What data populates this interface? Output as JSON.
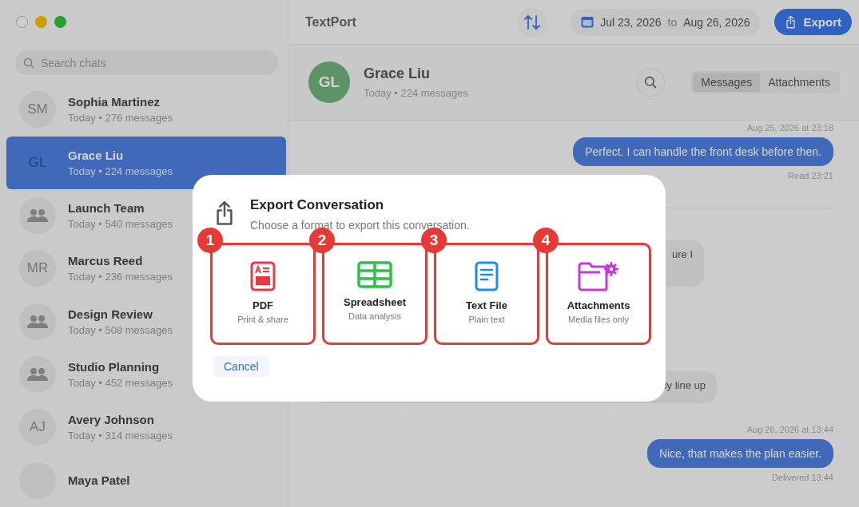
{
  "window": {
    "title": "TextPort"
  },
  "toolbar": {
    "date_from": "Jul 23, 2026",
    "date_sep": "to",
    "date_to": "Aug 26, 2026",
    "export_label": "Export"
  },
  "sidebar": {
    "search": {
      "placeholder": "Search chats"
    },
    "items": [
      {
        "kind": "person",
        "initials": "SM",
        "name": "Sophia Martinez",
        "meta": "Today • 276 messages",
        "selected": false
      },
      {
        "kind": "person",
        "initials": "GL",
        "name": "Grace Liu",
        "meta": "Today • 224 messages",
        "selected": true
      },
      {
        "kind": "group",
        "name": "Launch Team",
        "meta": "Today • 540 messages",
        "selected": false
      },
      {
        "kind": "person",
        "initials": "MR",
        "name": "Marcus Reed",
        "meta": "Today • 236 messages",
        "selected": false
      },
      {
        "kind": "group",
        "name": "Design Review",
        "meta": "Today • 508 messages",
        "selected": false
      },
      {
        "kind": "group",
        "name": "Studio Planning",
        "meta": "Today • 452 messages",
        "selected": false
      },
      {
        "kind": "person",
        "initials": "AJ",
        "name": "Avery Johnson",
        "meta": "Today • 314 messages",
        "selected": false
      },
      {
        "kind": "person",
        "name": "Maya Patel",
        "selected": false
      }
    ]
  },
  "chat": {
    "initials": "GL",
    "name": "Grace Liu",
    "meta": "Today • 224 messages",
    "tabs": [
      {
        "label": "Messages",
        "selected": true
      },
      {
        "label": "Attachments",
        "selected": false
      }
    ],
    "messages": [
      {
        "kind": "outgoing",
        "stamp": "Aug 25, 2026 at 23:18",
        "text": "Perfect. I can handle the front desk before then.",
        "status": "Read 23:21"
      },
      {
        "kind": "divider"
      },
      {
        "kind": "incoming",
        "text": "ure I"
      },
      {
        "kind": "incoming",
        "text": "ly line up"
      },
      {
        "kind": "outgoing",
        "stamp": "Aug 26, 2026 at 13:44",
        "text": "Nice, that makes the plan easier.",
        "status": "Delivered 13:44"
      }
    ]
  },
  "dialog": {
    "title": "Export Conversation",
    "subtitle": "Choose a format to export this conversation.",
    "options": [
      {
        "kind": "pdf",
        "marker": "1",
        "title": "PDF",
        "subtitle": "Print & share"
      },
      {
        "kind": "spreadsheet",
        "marker": "2",
        "title": "Spreadsheet",
        "subtitle": "Data analysis"
      },
      {
        "kind": "text",
        "marker": "3",
        "title": "Text File",
        "subtitle": "Plain text"
      },
      {
        "kind": "attachments",
        "marker": "4",
        "title": "Attachments",
        "subtitle": "Media files only"
      }
    ],
    "cancel": "Cancel"
  }
}
